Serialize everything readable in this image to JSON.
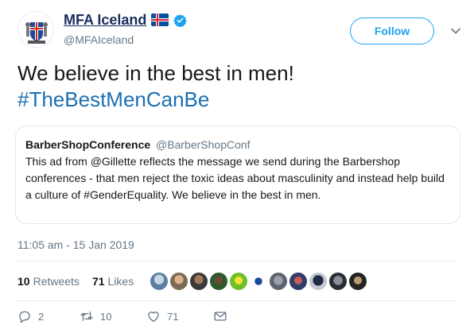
{
  "account": {
    "display_name": "MFA Iceland",
    "handle": "@MFAIceland",
    "flag_icon": "iceland-flag-icon",
    "verified_icon": "verified-badge-icon",
    "avatar_icon": "iceland-coat-of-arms-icon"
  },
  "follow_label": "Follow",
  "tweet": {
    "line1": "We believe in the best in men!",
    "hashtag": "#TheBestMenCanBe"
  },
  "quote": {
    "name": "BarberShopConference",
    "handle": "@BarberShopConf",
    "text": "This ad from @Gillette reflects the message we send during the Barbershop conferences - that men reject the toxic ideas about masculinity and instead help build a culture of #GenderEquality. We believe in the best in men."
  },
  "timestamp": "11:05 am - 15 Jan 2019",
  "stats": {
    "retweets_count": "10",
    "retweets_label": "Retweets",
    "likes_count": "71",
    "likes_label": "Likes"
  },
  "actions": {
    "replies": "2",
    "retweets": "10",
    "likes": "71"
  },
  "colors": {
    "accent": "#1da1f2",
    "display_name": "#1b2d5c",
    "hashtag": "#1b6fb2",
    "muted": "#657786"
  }
}
